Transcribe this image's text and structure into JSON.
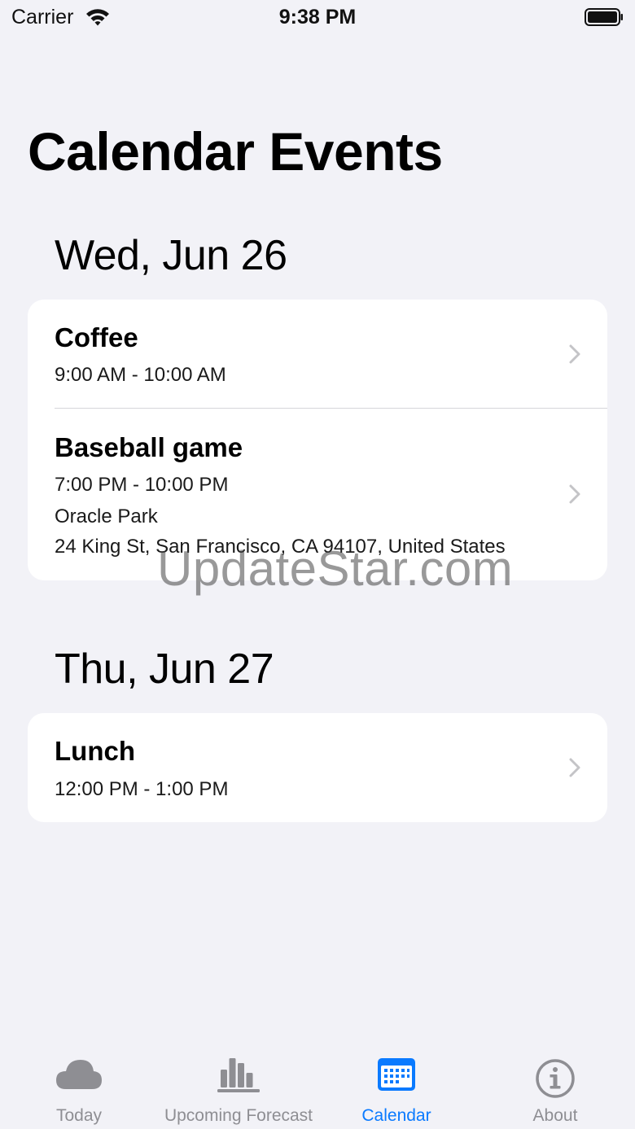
{
  "status_bar": {
    "carrier": "Carrier",
    "time": "9:38 PM",
    "icons": [
      "wifi-icon",
      "battery-icon"
    ]
  },
  "page": {
    "title": "Calendar Events"
  },
  "sections": [
    {
      "date": "Wed, Jun 26",
      "events": [
        {
          "title": "Coffee",
          "time": "9:00 AM - 10:00 AM",
          "location_name": "",
          "address": ""
        },
        {
          "title": "Baseball game",
          "time": "7:00 PM - 10:00 PM",
          "location_name": "Oracle Park",
          "address": "24 King St, San Francisco, CA  94107, United States"
        }
      ]
    },
    {
      "date": "Thu, Jun 27",
      "events": [
        {
          "title": "Lunch",
          "time": "12:00 PM - 1:00 PM",
          "location_name": "",
          "address": ""
        }
      ]
    }
  ],
  "watermark": "UpdateStar.com",
  "tab_bar": {
    "active": "Calendar",
    "accent_color": "#0a7aff",
    "inactive_color": "#8e8e93",
    "tabs": [
      {
        "label": "Today",
        "icon": "cloud-icon"
      },
      {
        "label": "Upcoming Forecast",
        "icon": "bar-chart-icon"
      },
      {
        "label": "Calendar",
        "icon": "calendar-icon"
      },
      {
        "label": "About",
        "icon": "info-icon"
      }
    ]
  }
}
